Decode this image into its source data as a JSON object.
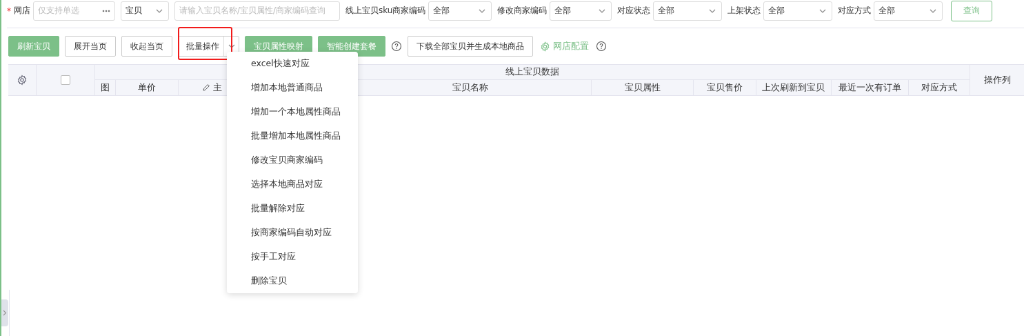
{
  "filters": {
    "shop": {
      "label": "网店",
      "required_mark": "*",
      "placeholder": "仅支持单选"
    },
    "type_select": {
      "value": "宝贝"
    },
    "search": {
      "placeholder": "请输入宝贝名称/宝贝属性/商家编码查询"
    },
    "selects": [
      {
        "label": "线上宝贝sku商家编码",
        "value": "全部"
      },
      {
        "label": "修改商家编码",
        "value": "全部"
      },
      {
        "label": "对应状态",
        "value": "全部"
      },
      {
        "label": "上架状态",
        "value": "全部"
      },
      {
        "label": "对应方式",
        "value": "全部"
      }
    ],
    "query_button": "查询"
  },
  "toolbar": [
    {
      "kind": "primary",
      "label": "刷新宝贝"
    },
    {
      "kind": "default",
      "label": "展开当页"
    },
    {
      "kind": "default",
      "label": "收起当页"
    },
    {
      "kind": "split",
      "label": "批量操作",
      "highlighted": true
    },
    {
      "kind": "primary",
      "label": "宝贝属性映射"
    },
    {
      "kind": "primary",
      "label": "智能创建套餐"
    },
    {
      "kind": "help"
    },
    {
      "kind": "default",
      "label": "下载全部宝贝并生成本地商品"
    },
    {
      "kind": "link",
      "label": "网店配置"
    },
    {
      "kind": "help"
    }
  ],
  "table": {
    "group_header": "线上宝贝数据",
    "columns": [
      "图",
      "单价",
      "主",
      "宝贝名称",
      "宝贝属性",
      "宝贝售价",
      "上次刷新到宝贝",
      "最近一次有订单",
      "对应方式"
    ],
    "action_column": "操作列",
    "select_all": {
      "checked": false
    }
  },
  "menu": {
    "items": [
      "excel快速对应",
      "增加本地普通商品",
      "增加一个本地属性商品",
      "批量增加本地属性商品",
      "修改宝贝商家编码",
      "选择本地商品对应",
      "批量解除对应",
      "按商家编码自动对应",
      "按手工对应",
      "删除宝贝"
    ]
  }
}
